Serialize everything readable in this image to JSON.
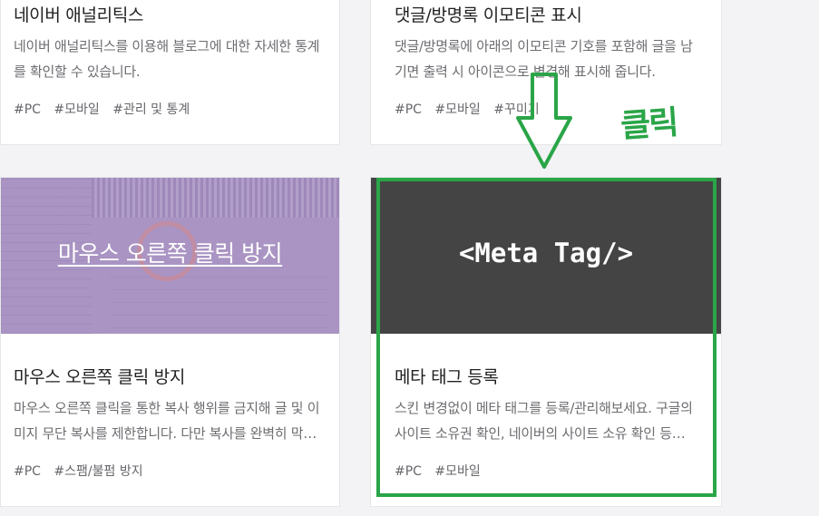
{
  "cards": [
    {
      "title": "네이버 애널리틱스",
      "description": "네이버 애널리틱스를 이용해 블로그에 대한 자세한 통계를 확인할 수 있습니다.",
      "tags": [
        "#PC",
        "#모바일",
        "#관리 및 통계"
      ]
    },
    {
      "title": "댓글/방명록 이모티콘 표시",
      "description": "댓글/방명록에 아래의 이모티콘 기호를 포함해 글을 남기면 출력 시 아이콘으로 변경해 표시해 줍니다.",
      "tags": [
        "#PC",
        "#모바일",
        "#꾸미기"
      ]
    },
    {
      "thumbnail_text": "마우스 오른쪽 클릭 방지",
      "title": "마우스 오른쪽 클릭 방지",
      "description": "마우스 오른쪽 클릭을 통한 복사 행위를 금지해 글 및 이미지 무단 복사를 제한합니다. 다만 복사를 완벽히 막을 수는 없습니다.",
      "tags": [
        "#PC",
        "#스팸/불펌 방지"
      ]
    },
    {
      "thumbnail_text": "<Meta Tag/>",
      "title": "메타 태그 등록",
      "description": "스킨 변경없이 메타 태그를 등록/관리해보세요. 구글의 사이트 소유권 확인, 네이버의 사이트 소유 확인 등에 활용할 수 있습니다.",
      "tags": [
        "#PC",
        "#모바일"
      ]
    }
  ],
  "annotation": {
    "text": "클릭",
    "color": "#2aa548",
    "arrow_icon": "down-arrow-icon"
  },
  "colors": {
    "background": "#f3f3f5",
    "purple_thumbnail": "#a994c3",
    "dark_thumbnail": "#444444"
  }
}
